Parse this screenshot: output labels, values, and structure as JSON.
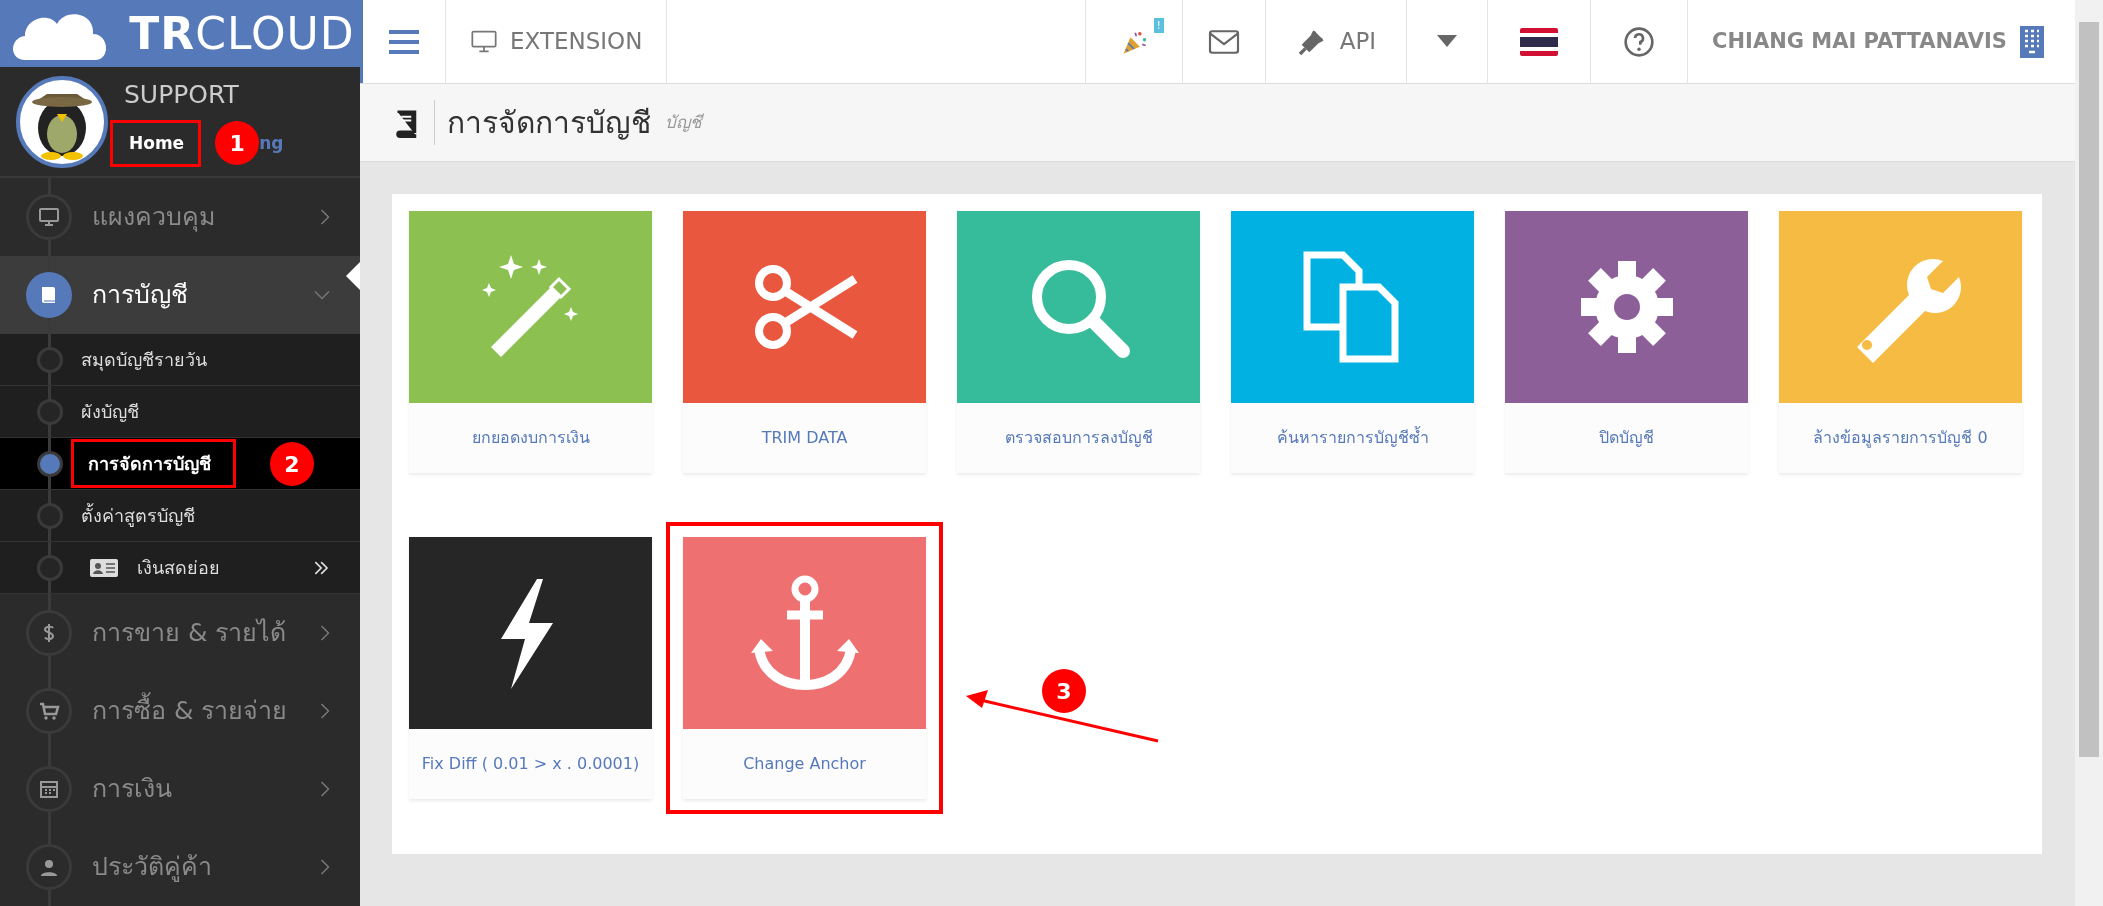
{
  "logo": {
    "bold": "TR",
    "rest": "CLOUD"
  },
  "user": {
    "name": "SUPPORT",
    "links": [
      "Home",
      "ng"
    ]
  },
  "sidebar": {
    "items": [
      {
        "label": "แผงควบคุม",
        "expanded": false,
        "selected": false
      },
      {
        "label": "การบัญชี",
        "expanded": true,
        "selected": true,
        "children": [
          {
            "label": "สมุดบัญชีรายวัน",
            "selected": false
          },
          {
            "label": "ผังบัญชี",
            "selected": false
          },
          {
            "label": "การจัดการบัญชี",
            "selected": true
          },
          {
            "label": "ตั้งค่าสูตรบัญชี",
            "selected": false
          },
          {
            "label": "เงินสดย่อย",
            "selected": false,
            "kind": "submenu"
          }
        ]
      },
      {
        "label": "การขาย & รายได้",
        "expanded": false,
        "selected": false
      },
      {
        "label": "การซื้อ & รายจ่าย",
        "expanded": false,
        "selected": false
      },
      {
        "label": "การเงิน",
        "expanded": false,
        "selected": false
      },
      {
        "label": "ประวัติคู่ค้า",
        "expanded": false,
        "selected": false
      }
    ]
  },
  "topbar": {
    "extension": "EXTENSION",
    "notification_badge": "!",
    "api": "API",
    "company": "CHIANG MAI PATTANAVIS"
  },
  "page_header": {
    "title": "การจัดการบัญชี",
    "subtitle": "บัญชี"
  },
  "tiles": [
    {
      "label": "ยกยอดงบการเงิน",
      "color": "#8cc152"
    },
    {
      "label": "TRIM DATA",
      "color": "#e9573f"
    },
    {
      "label": "ตรวจสอบการลงบัญชี",
      "color": "#37bc9b"
    },
    {
      "label": "ค้นหารายการบัญชีซ้ำ",
      "color": "#00b1e1"
    },
    {
      "label": "ปิดบัญชี",
      "color": "#8c5f99"
    },
    {
      "label": "ล้างข้อมูลรายการบัญชี 0",
      "color": "#f6bb42"
    },
    {
      "label": "Fix Diff ( 0.01 > x . 0.0001)",
      "color": "#262626"
    },
    {
      "label": "Change Anchor",
      "color": "#ef7070"
    }
  ],
  "callouts": [
    "1",
    "2",
    "3"
  ]
}
